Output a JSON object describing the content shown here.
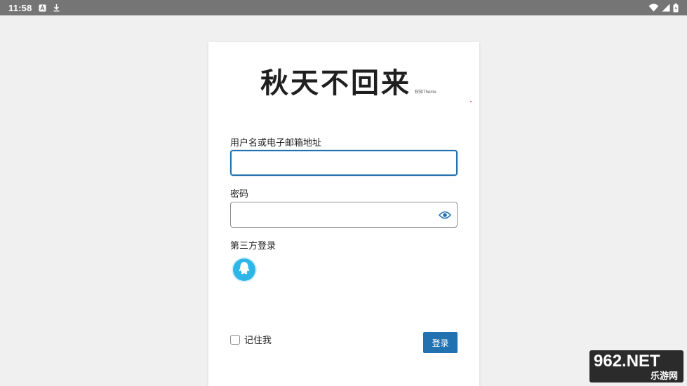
{
  "status_bar": {
    "time": "11:58",
    "icons_left": [
      "a-notification-icon",
      "download-icon"
    ],
    "icons_right": [
      "wifi-icon",
      "signal-icon",
      "battery-icon"
    ]
  },
  "logo": {
    "title": "秋天不回来",
    "subtitle": "秋知Theme"
  },
  "form": {
    "username_label": "用户名或电子邮箱地址",
    "username_value": "",
    "password_label": "密码",
    "password_value": "",
    "third_party_label": "第三方登录",
    "third_party_icon": "qq-icon",
    "remember_label": "记住我",
    "remember_checked": false,
    "login_label": "登录"
  },
  "watermark": {
    "brand": "962.NET",
    "sub": "乐游网"
  },
  "colors": {
    "accent": "#2271b1",
    "page_bg": "#f0f0f1",
    "status_bar": "#757575",
    "qq": "#2fb6e8"
  }
}
